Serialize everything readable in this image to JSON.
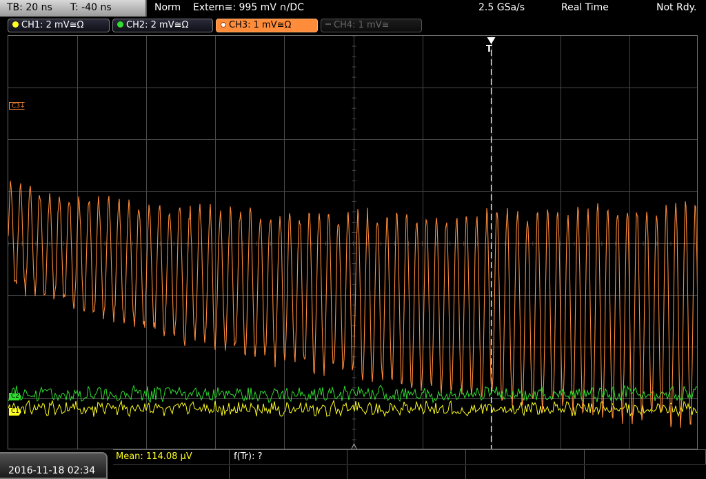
{
  "header": {
    "timebase": "TB: 20 ns",
    "trigger_time": "T: -40 ns",
    "acq_mode": "Norm",
    "trigger_source": "Extern≅: 995 mV ∩/DC",
    "sample_rate": "2.5 GSa/s",
    "mode": "Real Time",
    "status": "Not Rdy."
  },
  "channels": [
    {
      "label": "CH1: 2 mV≅Ω",
      "color": "#ffff20",
      "active": false,
      "enabled": true
    },
    {
      "label": "CH2: 2 mV≅Ω",
      "color": "#30dd30",
      "active": false,
      "enabled": true
    },
    {
      "label": "CH3: 1 mV≅Ω",
      "color": "#ff8c3a",
      "active": true,
      "enabled": true
    },
    {
      "label": "CH4: 1 mV≅",
      "color": "#555555",
      "active": false,
      "enabled": false
    }
  ],
  "markers": {
    "ch3": "C3↓",
    "ch2": "C2",
    "ch1": "C1",
    "trigger": "T"
  },
  "measurements": {
    "mean": "Mean: 114.08 µV",
    "ftr": "f(Tr): ?"
  },
  "datetime": "2016-11-18 02:34",
  "colors": {
    "ch1": "#ffff20",
    "ch2": "#30dd30",
    "ch3": "#ff8c3a",
    "grid": "#4a4a4a"
  }
}
